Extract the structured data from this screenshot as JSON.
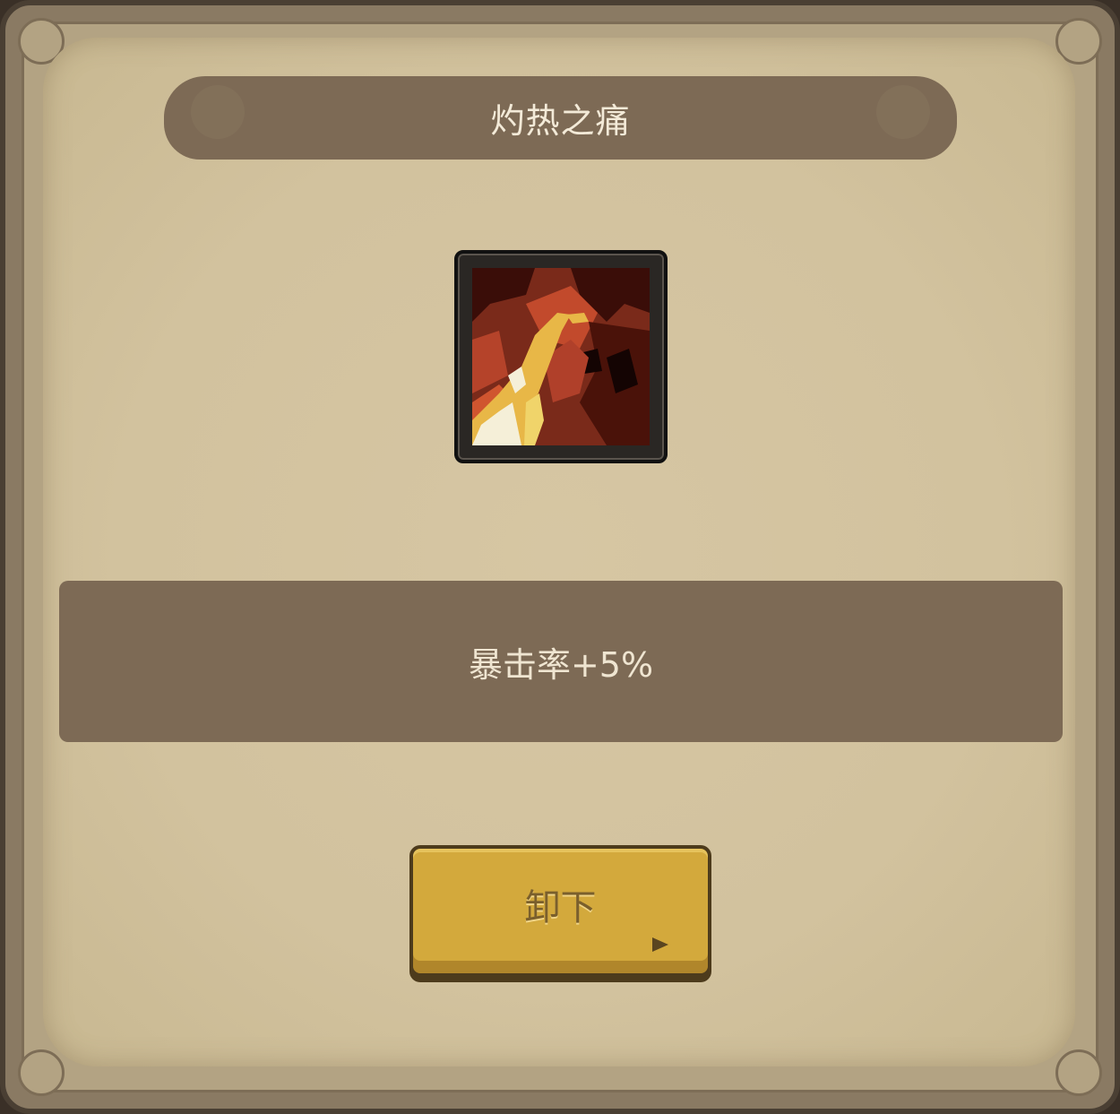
{
  "panel": {
    "title": "灼热之痛",
    "icon": "fire-skill-icon",
    "description": "暴击率+5%",
    "unequip_label": "卸下"
  },
  "colors": {
    "banner": "#7d6a55",
    "parchment": "#d2c29e",
    "button": "#d3a93c",
    "title_text": "#f3ead8"
  }
}
